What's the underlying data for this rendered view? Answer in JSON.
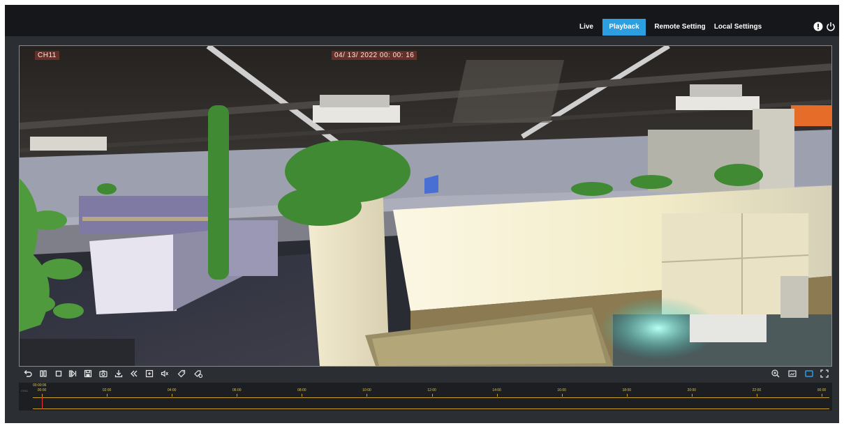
{
  "nav": {
    "live": "Live",
    "playback": "Playback",
    "remote": "Remote Setting",
    "local": "Local Settings"
  },
  "video": {
    "channel": "CH11",
    "timestamp": "04/ 13/ 2022  00: 00: 16"
  },
  "controls": {
    "left": [
      "return-icon",
      "pause-icon",
      "stop-icon",
      "next-frame-icon",
      "save-icon",
      "snapshot-icon",
      "download-icon",
      "rewind-icon",
      "clip-icon",
      "volume-icon",
      "tag-icon",
      "tag-settings-icon"
    ],
    "right": [
      "zoom-icon",
      "fit-screen-icon",
      "single-screen-icon",
      "fullscreen-icon"
    ]
  },
  "timeline": {
    "current_time": "00:00:06",
    "row_label": "CH11",
    "ticks": [
      "00:00",
      "02:00",
      "04:00",
      "06:00",
      "08:00",
      "10:00",
      "12:00",
      "14:00",
      "16:00",
      "18:00",
      "20:00",
      "22:00",
      "00:00"
    ]
  },
  "colors": {
    "accent": "#2b9fe0",
    "timeline_marker": "#e53935",
    "timeline_track": "#c9a227",
    "frame_border": "#3aa6c8"
  }
}
